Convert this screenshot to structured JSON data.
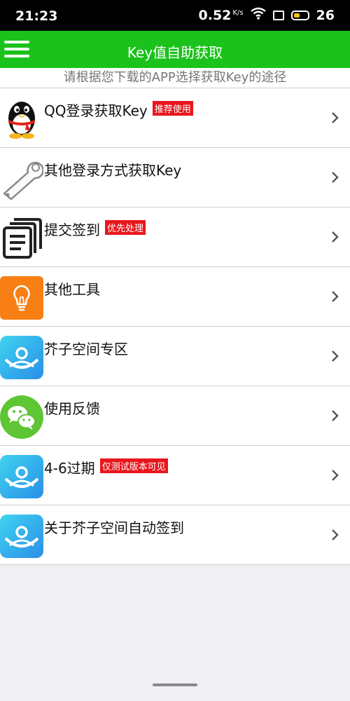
{
  "status_bar": {
    "time": "21:23",
    "net_speed": "0.52",
    "net_unit": "K/s",
    "battery_level": "26"
  },
  "app_bar": {
    "title": "Key值自助获取",
    "color": "#1bc21b"
  },
  "hint_text": "请根据您下载的APP选择获取Key的途径",
  "items": [
    {
      "label": "QQ登录获取Key",
      "badge": "推荐使用",
      "icon": "qq-penguin-icon"
    },
    {
      "label": "其他登录方式获取Key",
      "badge": "",
      "icon": "wrench-icon"
    },
    {
      "label": "提交签到",
      "badge": "优先处理",
      "icon": "documents-icon"
    },
    {
      "label": "其他工具",
      "badge": "",
      "icon": "lightbulb-icon"
    },
    {
      "label": "芥子空间专区",
      "badge": "",
      "icon": "jiezi-space-icon"
    },
    {
      "label": "使用反馈",
      "badge": "",
      "icon": "wechat-icon"
    },
    {
      "label": "4-6过期",
      "badge": "仅测试版本可见",
      "icon": "jiezi-space-icon"
    },
    {
      "label": "关于芥子空间自动签到",
      "badge": "",
      "icon": "jiezi-space-icon"
    }
  ],
  "badge_color": "#e8161d"
}
